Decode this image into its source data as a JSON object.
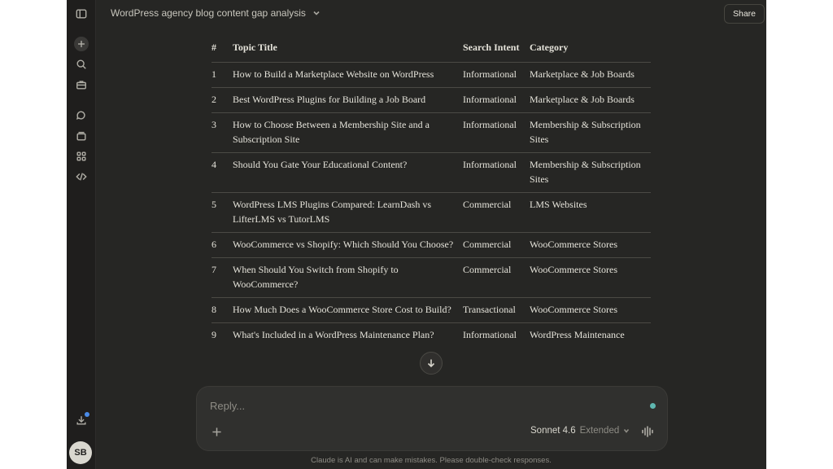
{
  "topbar": {
    "chat_title": "WordPress agency blog content gap analysis",
    "share_label": "Share"
  },
  "sidebar": {
    "icons": [
      "sidebar-toggle-icon",
      "new-chat-icon",
      "search-icon",
      "briefcase-icon",
      "chats-icon",
      "projects-icon",
      "artifacts-icon",
      "code-icon",
      "download-icon"
    ],
    "avatar_initials": "SB"
  },
  "table": {
    "headers": {
      "num": "#",
      "title": "Topic Title",
      "intent": "Search Intent",
      "category": "Category"
    },
    "rows": [
      {
        "num": "1",
        "title": "How to Build a Marketplace Website on WordPress",
        "intent": "Informational",
        "category": "Marketplace & Job Boards"
      },
      {
        "num": "2",
        "title": "Best WordPress Plugins for Building a Job Board",
        "intent": "Informational",
        "category": "Marketplace & Job Boards"
      },
      {
        "num": "3",
        "title": "How to Choose Between a Membership Site and a Subscription Site",
        "intent": "Informational",
        "category": "Membership & Subscription Sites"
      },
      {
        "num": "4",
        "title": "Should You Gate Your Educational Content?",
        "intent": "Informational",
        "category": "Membership & Subscription Sites"
      },
      {
        "num": "5",
        "title": "WordPress LMS Plugins Compared: LearnDash vs LifterLMS vs TutorLMS",
        "intent": "Commercial",
        "category": "LMS Websites"
      },
      {
        "num": "6",
        "title": "WooCommerce vs Shopify: Which Should You Choose?",
        "intent": "Commercial",
        "category": "WooCommerce Stores"
      },
      {
        "num": "7",
        "title": "When Should You Switch from Shopify to WooCommerce?",
        "intent": "Commercial",
        "category": "WooCommerce Stores"
      },
      {
        "num": "8",
        "title": "How Much Does a WooCommerce Store Cost to Build?",
        "intent": "Transactional",
        "category": "WooCommerce Stores"
      },
      {
        "num": "9",
        "title": "What's Included in a WordPress Maintenance Plan?",
        "intent": "Informational",
        "category": "WordPress Maintenance"
      }
    ]
  },
  "composer": {
    "placeholder": "Reply...",
    "model_name": "Sonnet 4.6",
    "model_mode": "Extended"
  },
  "footer": {
    "disclaimer": "Claude is AI and can make mistakes. Please double-check responses."
  }
}
